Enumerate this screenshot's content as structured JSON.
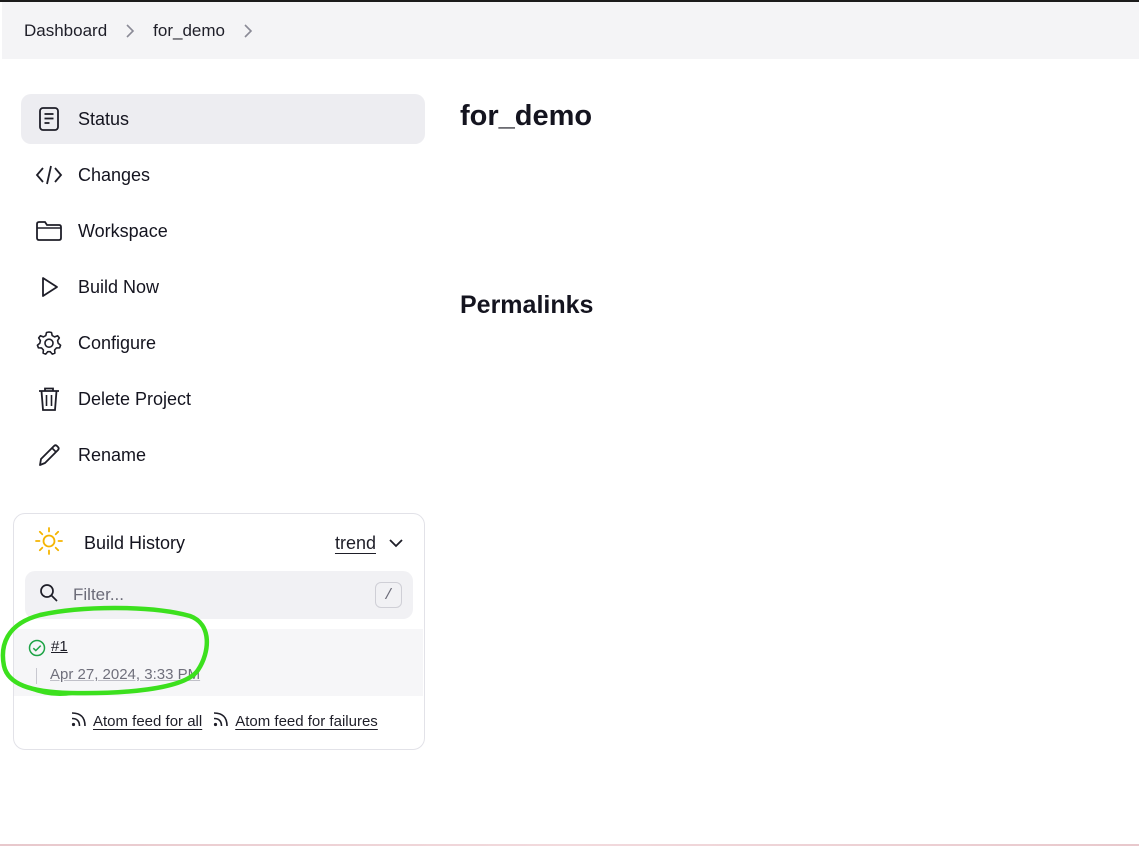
{
  "breadcrumb": {
    "items": [
      "Dashboard",
      "for_demo"
    ]
  },
  "sidebar": {
    "tasks": [
      {
        "label": "Status",
        "icon": "status-icon"
      },
      {
        "label": "Changes",
        "icon": "code-icon"
      },
      {
        "label": "Workspace",
        "icon": "folder-icon"
      },
      {
        "label": "Build Now",
        "icon": "play-icon"
      },
      {
        "label": "Configure",
        "icon": "gear-icon"
      },
      {
        "label": "Delete Project",
        "icon": "trash-icon"
      },
      {
        "label": "Rename",
        "icon": "pencil-icon"
      }
    ]
  },
  "build_history": {
    "title": "Build History",
    "trend_label": "trend",
    "filter_placeholder": "Filter...",
    "shortcut": "/",
    "builds": [
      {
        "number": "#1",
        "date": "Apr 27, 2024, 3:33 PM",
        "status": "success"
      }
    ],
    "feed_all": "Atom feed for all",
    "feed_failures": "Atom feed for failures"
  },
  "main": {
    "title": "for_demo",
    "permalinks_heading": "Permalinks"
  },
  "colors": {
    "success": "#1ea446",
    "sun": "#f5b400",
    "annotation": "#3ce01e",
    "active_bg": "#ededf1"
  }
}
